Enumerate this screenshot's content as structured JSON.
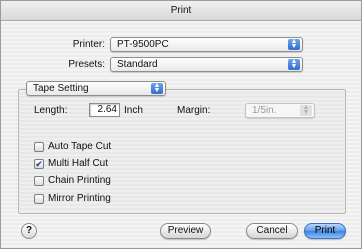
{
  "window": {
    "title": "Print"
  },
  "printer": {
    "label": "Printer:",
    "value": "PT-9500PC"
  },
  "presets": {
    "label": "Presets:",
    "value": "Standard"
  },
  "section": {
    "value": "Tape Setting"
  },
  "length": {
    "label": "Length:",
    "value": "2.64",
    "unit": "Inch"
  },
  "margin": {
    "label": "Margin:",
    "value": "1/5in."
  },
  "options": [
    {
      "label": "Auto Tape Cut",
      "checked": false
    },
    {
      "label": "Multi Half Cut",
      "checked": true
    },
    {
      "label": "Chain Printing",
      "checked": false
    },
    {
      "label": "Mirror Printing",
      "checked": false
    }
  ],
  "buttons": {
    "help": "?",
    "preview": "Preview",
    "cancel": "Cancel",
    "print": "Print"
  },
  "icons": {
    "popup_arrows": "up-down-arrows-icon",
    "checkmark": "checkmark-icon"
  },
  "colors": {
    "accent": "#3e82e0"
  }
}
